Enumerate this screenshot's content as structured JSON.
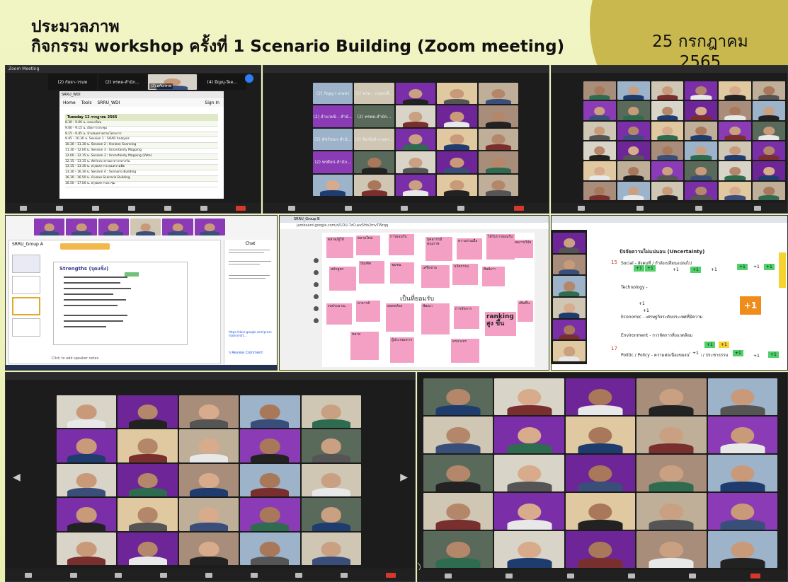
{
  "slide": {
    "title_line1": "ประมวลภาพ",
    "title_line2": "กิจกรรม workshop ครั้งที่ 1 Scenario Building (Zoom meeting)",
    "date_line1": "25 กรกฎาคม",
    "date_line2": "2565"
  },
  "colors": {
    "background": "#eef3bd",
    "date_circle": "#c8b84e",
    "zoom_dark": "#1c1c1c",
    "purple_tile": "#7a2fa8",
    "sticky_pink": "#f3a0c4",
    "leave_red": "#d9362c"
  },
  "panels": {
    "p1": {
      "window_title": "Zoom Meeting",
      "tiles": [
        "(2) กัลยา-วรนพ",
        "(2) ทรพล-สำนัก...",
        "(2) สุกัน-สวพ",
        "(4) มีญญุ-Tee..."
      ],
      "doc_tab": "SRRU_WDI",
      "doc_menu": [
        "Home",
        "Tools",
        "SRRU_WDI"
      ],
      "doc_signin": "Sign In",
      "doc_heading": "Tuesday 12 กรกฎาคม 2565",
      "agenda": [
        "8.30 - 9.00 น.   ลงทะเบียน",
        "9.00 - 9.15 น.   เปิดการประชุม",
        "9.15 - 9.45 น.   นำเสนอภาพรวมโครงการ",
        "9.45 - 10.30 น.  Session 1 : SOAR Analysis",
        "10.30 - 11.30 น. Session 2 : Horizon Scanning",
        "11.30 - 12.00 น. Session 3 : Uncertainty Mapping",
        "12.00 - 12.15 น. Session 3 : Uncertainty Mapping (Vote)",
        "12.15 - 13.15 น. พักรับประทานอาหารกลางวัน",
        "13.15 - 13.30 น. สรุปผลการระดมความคิด",
        "13.30 - 16.30 น. Session 4 : Scenario Building",
        "16.30 - 16.50 น. นำเสนอ Scenario Building",
        "16.50 - 17.00 น. สรุปผลการประชุม"
      ]
    },
    "p2": {
      "tiles": [
        "(2) กัญญา-เกษตร",
        "(2) พรพ - เกษตรศึ...",
        "(2) อำนวยนิ - สำนั...",
        "(2) ทรพล-สำนัก...",
        "(2) พัชร์ชนก-สำนั...",
        "(2) ชิดชัยศ์-เกษตร...",
        "(2) พรศิลป-สำนัก..."
      ]
    },
    "p4": {
      "slides_title": "SRRU_Group A",
      "section": "Strengths (จุดแข็ง)",
      "click_note": "Click to add speaker notes",
      "chat_title": "Chat",
      "chat_link": "https://docs.google.com/presentation/d/1...",
      "chat_footer": "ๆ Review Comment"
    },
    "p5": {
      "board_title": "SRRU_Group B",
      "url": "jamboard.google.com/d/1DU-7zCuxx5Ho2mvTWrqq",
      "center_label": "เป็นที่ยอมรับ",
      "ranking": "ranking สูง ขึ้น",
      "stickies": [
        "ตลาด/ผู้ใช้",
        "ตลาดใหม่",
        "การยอมรับ",
        "บุคลากรมีคุณภาพ",
        "ความร่วมมือ",
        "ได้รับการยอมรับ",
        "ผลงานวิจัย",
        "หลักสูตร",
        "บัณฑิต",
        "ชุมชน",
        "เครือข่าย",
        "นวัตกรรม",
        "ศิษย์เก่า",
        "งบประมาณ",
        "อาจารย์",
        "สอดคล้อง",
        "พัฒนา",
        "การจัดการ",
        "เพิ่มขึ้น",
        "ขยาย",
        "ผู้ประกอบการ",
        "ครบวงจร"
      ]
    },
    "p6": {
      "heading": "ปัจจัยความไม่แน่นอน (Uncertainty)",
      "rows": [
        "Social - สังคมที่ / กำลังเปลี่ยนแปลงไป",
        "Technology -",
        "Economic - เศรษฐกิจระดับประเทศที่มีความ",
        "Environment - การจัดการสิ่งแวดล้อม",
        "Politic / Policy - ความต่อเนื่องของนโยบาย / ประชาธรรม"
      ],
      "plus": "+1",
      "num15": "15",
      "num17": "17"
    }
  }
}
